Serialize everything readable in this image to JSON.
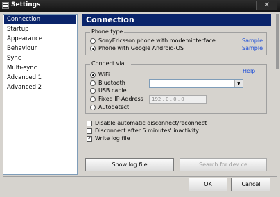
{
  "window": {
    "title": "Settings",
    "close_glyph": "✕"
  },
  "nav": {
    "items": [
      {
        "label": "Connection"
      },
      {
        "label": "Startup"
      },
      {
        "label": "Appearance"
      },
      {
        "label": "Behaviour"
      },
      {
        "label": "Sync"
      },
      {
        "label": "Multi-sync"
      },
      {
        "label": "Advanced 1"
      },
      {
        "label": "Advanced 2"
      }
    ],
    "selected": "Connection"
  },
  "header": {
    "title": "Connection"
  },
  "phone_type": {
    "title": "Phone type",
    "options": [
      {
        "label": "SonyEricsson phone with modeminterface",
        "checked": false,
        "link": "Sample"
      },
      {
        "label": "Phone with Google Android-OS",
        "checked": true,
        "link": "Sample"
      }
    ]
  },
  "connect_via": {
    "title": "Connect via...",
    "help": "Help",
    "options": [
      {
        "label": "WiFi",
        "checked": true
      },
      {
        "label": "Bluetooth",
        "checked": false
      },
      {
        "label": "USB cable",
        "checked": false
      },
      {
        "label": "Fixed IP-Address",
        "checked": false
      },
      {
        "label": "Autodetect",
        "checked": false
      }
    ],
    "bluetooth_value": "",
    "ip_value": "192 .  0  .  0  .  0"
  },
  "checkboxes": [
    {
      "label": "Disable automatic disconnect/reconnect",
      "checked": false
    },
    {
      "label": "Disconnect after 5 minutes' inactivity",
      "checked": false
    },
    {
      "label": "Write log file",
      "checked": true
    }
  ],
  "buttons": {
    "show_log": "Show log file",
    "search_device": "Search for device",
    "ok": "OK",
    "cancel": "Cancel"
  },
  "colors": {
    "selection": "#0a246a",
    "link": "#1d4ed8"
  },
  "icons": {
    "app": "settings-app-icon",
    "close": "close-icon",
    "dropdown": "chevron-down-icon"
  }
}
